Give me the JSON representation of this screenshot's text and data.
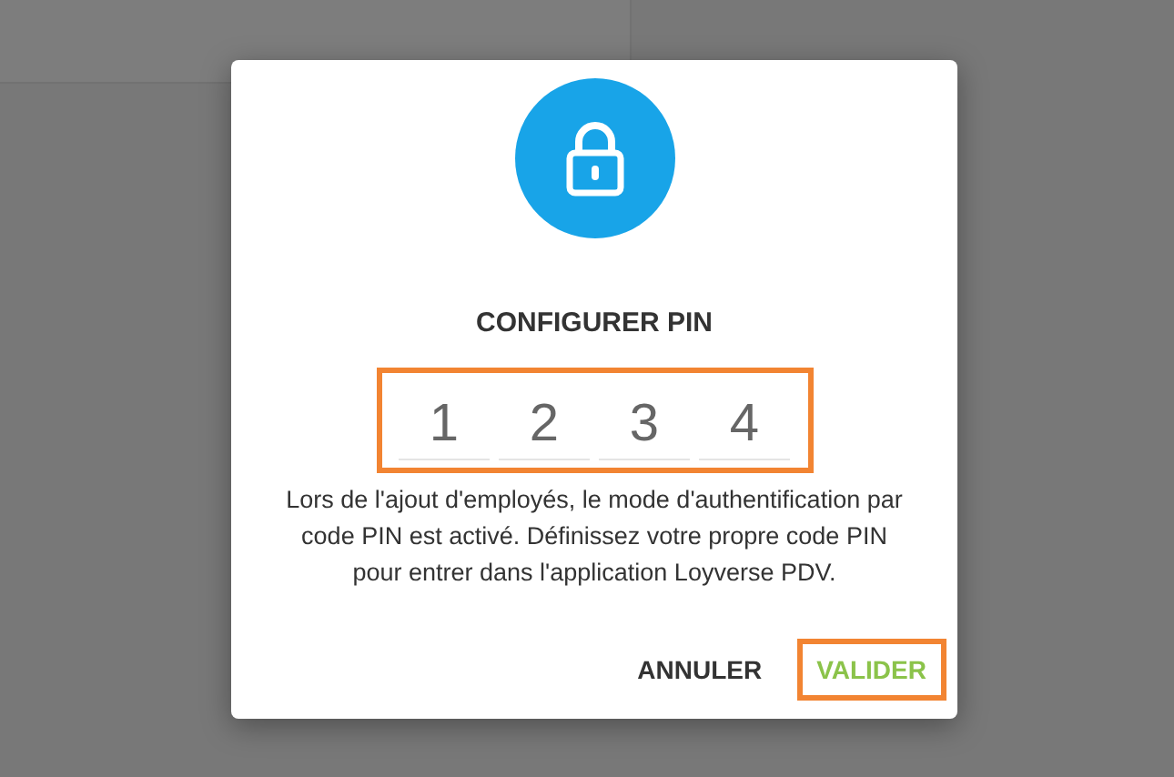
{
  "dialog": {
    "title": "CONFIGURER PIN",
    "pin": {
      "highlighted": true,
      "digits": [
        "1",
        "2",
        "3",
        "4"
      ]
    },
    "message": "Lors de l'ajout d'employés, le mode d'authentification par code PIN est activé. Définissez votre propre code PIN pour entrer dans l'application Loyverse PDV.",
    "buttons": [
      {
        "label": "ANNULER",
        "kind": "secondary",
        "highlighted": false
      },
      {
        "label": "VALIDER",
        "kind": "primary",
        "highlighted": true
      }
    ]
  }
}
